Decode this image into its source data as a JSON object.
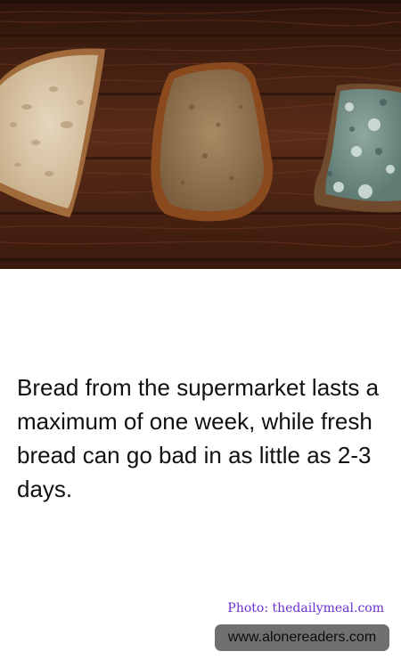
{
  "image": {
    "alt": "Three slices of bread on a dark wooden table: fresh, browned and moldy"
  },
  "caption": {
    "text": "Bread from the supermarket lasts a maximum of one week, while fresh bread can go bad in as little as 2-3 days."
  },
  "credit": {
    "text": "Photo: thedailymeal.com"
  },
  "watermark": {
    "text": "www.alonereaders.com"
  },
  "colors": {
    "background": "#ffffff",
    "caption_text": "#111111",
    "credit_text": "#6b2fd6",
    "watermark_bg": "#707070",
    "wood_dark": "#3a1a0e",
    "wood_light": "#6b3520"
  }
}
